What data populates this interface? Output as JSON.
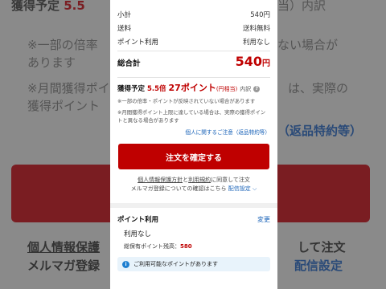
{
  "background": {
    "line1_left": "獲得予定",
    "line1_num": "5.5",
    "line1_right": "当）内訳",
    "line2": "※一部の倍率",
    "line2_right": "ない場合が",
    "line3": "あります",
    "line4": "※月間獲得ポイ",
    "line4_right": "は、実際の",
    "line5": "獲得ポイント",
    "line6_right": "（返品特約等）",
    "line7_left": "個人情報保護",
    "line7_right": "して注文",
    "line8_left": "メルマガ登録",
    "line8_right": "配信設定"
  },
  "summary": {
    "rows": [
      {
        "label": "小計",
        "value": "540円"
      },
      {
        "label": "送料",
        "value": "送料無料"
      },
      {
        "label": "ポイント利用",
        "value": "利用なし"
      }
    ],
    "total_label": "総合計",
    "total_value": "540",
    "total_unit": "円"
  },
  "points": {
    "label": "獲得予定",
    "rate": "5.5倍",
    "amount": "27ポイント",
    "amount_note": "(円相当)",
    "breakdown": "内訳"
  },
  "notes": {
    "note1": "※一部の倍率・ポイントが反映されていない場合があります",
    "note2": "※月間獲得ポイント上限に達している場合は、実際の獲得ポイントと異なる場合があります",
    "link": "個人に関するご注意（返品特約等）"
  },
  "confirm_button": "注文を確定する",
  "consent": {
    "privacy": "個人情報保護方針",
    "and": "と",
    "terms": "利用規約",
    "rest1": "に同意して注文",
    "rest2": "メルマガ登録についての確認はこちら",
    "settings": "配信設定"
  },
  "point_usage": {
    "title": "ポイント利用",
    "edit": "変更",
    "value": "利用なし",
    "balance_label": "総保有ポイント残高：",
    "balance_value": "580",
    "notice": "ご利用可能なポイントがあります"
  }
}
